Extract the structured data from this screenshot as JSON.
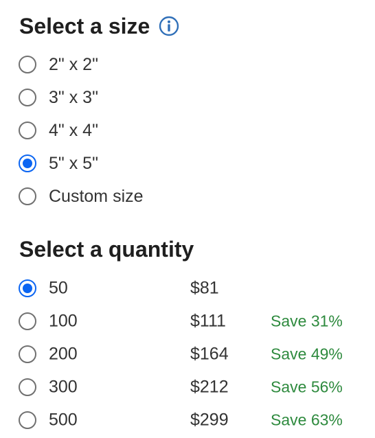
{
  "size_section": {
    "title": "Select a size",
    "info_icon": "info-circle-icon",
    "options": [
      {
        "label": "2\" x 2\"",
        "selected": false
      },
      {
        "label": "3\" x 3\"",
        "selected": false
      },
      {
        "label": "4\" x 4\"",
        "selected": false
      },
      {
        "label": "5\" x 5\"",
        "selected": true
      },
      {
        "label": "Custom size",
        "selected": false
      }
    ]
  },
  "quantity_section": {
    "title": "Select a quantity",
    "options": [
      {
        "quantity": "50",
        "price": "$81",
        "savings": "",
        "selected": true
      },
      {
        "quantity": "100",
        "price": "$111",
        "savings": "Save 31%",
        "selected": false
      },
      {
        "quantity": "200",
        "price": "$164",
        "savings": "Save 49%",
        "selected": false
      },
      {
        "quantity": "300",
        "price": "$212",
        "savings": "Save 56%",
        "selected": false
      },
      {
        "quantity": "500",
        "price": "$299",
        "savings": "Save 63%",
        "selected": false
      }
    ]
  },
  "colors": {
    "accent": "#0b65f2",
    "info_icon": "#2f6fb8",
    "savings": "#2e8a3e",
    "heading": "#1f1f1f",
    "text": "#333333"
  }
}
